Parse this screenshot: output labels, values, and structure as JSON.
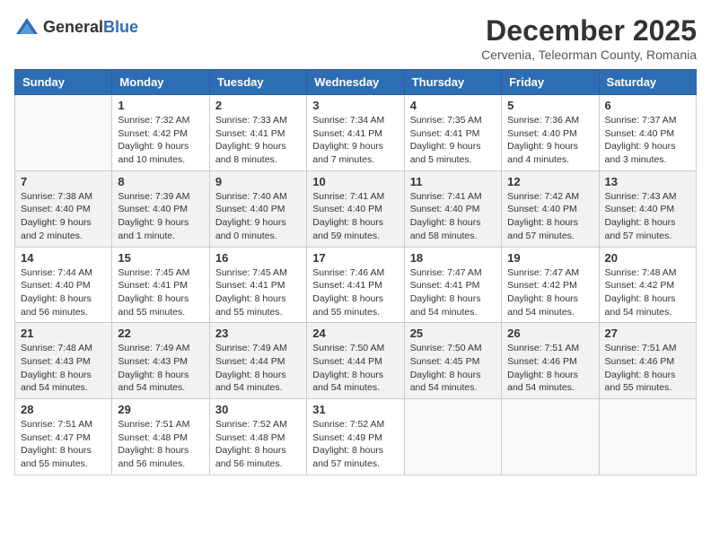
{
  "header": {
    "logo": {
      "general": "General",
      "blue": "Blue"
    },
    "month_title": "December 2025",
    "subtitle": "Cervenia, Teleorman County, Romania"
  },
  "weekdays": [
    "Sunday",
    "Monday",
    "Tuesday",
    "Wednesday",
    "Thursday",
    "Friday",
    "Saturday"
  ],
  "weeks": [
    [
      {
        "day": "",
        "sunrise": "",
        "sunset": "",
        "daylight": ""
      },
      {
        "day": "1",
        "sunrise": "Sunrise: 7:32 AM",
        "sunset": "Sunset: 4:42 PM",
        "daylight": "Daylight: 9 hours and 10 minutes."
      },
      {
        "day": "2",
        "sunrise": "Sunrise: 7:33 AM",
        "sunset": "Sunset: 4:41 PM",
        "daylight": "Daylight: 9 hours and 8 minutes."
      },
      {
        "day": "3",
        "sunrise": "Sunrise: 7:34 AM",
        "sunset": "Sunset: 4:41 PM",
        "daylight": "Daylight: 9 hours and 7 minutes."
      },
      {
        "day": "4",
        "sunrise": "Sunrise: 7:35 AM",
        "sunset": "Sunset: 4:41 PM",
        "daylight": "Daylight: 9 hours and 5 minutes."
      },
      {
        "day": "5",
        "sunrise": "Sunrise: 7:36 AM",
        "sunset": "Sunset: 4:40 PM",
        "daylight": "Daylight: 9 hours and 4 minutes."
      },
      {
        "day": "6",
        "sunrise": "Sunrise: 7:37 AM",
        "sunset": "Sunset: 4:40 PM",
        "daylight": "Daylight: 9 hours and 3 minutes."
      }
    ],
    [
      {
        "day": "7",
        "sunrise": "Sunrise: 7:38 AM",
        "sunset": "Sunset: 4:40 PM",
        "daylight": "Daylight: 9 hours and 2 minutes."
      },
      {
        "day": "8",
        "sunrise": "Sunrise: 7:39 AM",
        "sunset": "Sunset: 4:40 PM",
        "daylight": "Daylight: 9 hours and 1 minute."
      },
      {
        "day": "9",
        "sunrise": "Sunrise: 7:40 AM",
        "sunset": "Sunset: 4:40 PM",
        "daylight": "Daylight: 9 hours and 0 minutes."
      },
      {
        "day": "10",
        "sunrise": "Sunrise: 7:41 AM",
        "sunset": "Sunset: 4:40 PM",
        "daylight": "Daylight: 8 hours and 59 minutes."
      },
      {
        "day": "11",
        "sunrise": "Sunrise: 7:41 AM",
        "sunset": "Sunset: 4:40 PM",
        "daylight": "Daylight: 8 hours and 58 minutes."
      },
      {
        "day": "12",
        "sunrise": "Sunrise: 7:42 AM",
        "sunset": "Sunset: 4:40 PM",
        "daylight": "Daylight: 8 hours and 57 minutes."
      },
      {
        "day": "13",
        "sunrise": "Sunrise: 7:43 AM",
        "sunset": "Sunset: 4:40 PM",
        "daylight": "Daylight: 8 hours and 57 minutes."
      }
    ],
    [
      {
        "day": "14",
        "sunrise": "Sunrise: 7:44 AM",
        "sunset": "Sunset: 4:40 PM",
        "daylight": "Daylight: 8 hours and 56 minutes."
      },
      {
        "day": "15",
        "sunrise": "Sunrise: 7:45 AM",
        "sunset": "Sunset: 4:41 PM",
        "daylight": "Daylight: 8 hours and 55 minutes."
      },
      {
        "day": "16",
        "sunrise": "Sunrise: 7:45 AM",
        "sunset": "Sunset: 4:41 PM",
        "daylight": "Daylight: 8 hours and 55 minutes."
      },
      {
        "day": "17",
        "sunrise": "Sunrise: 7:46 AM",
        "sunset": "Sunset: 4:41 PM",
        "daylight": "Daylight: 8 hours and 55 minutes."
      },
      {
        "day": "18",
        "sunrise": "Sunrise: 7:47 AM",
        "sunset": "Sunset: 4:41 PM",
        "daylight": "Daylight: 8 hours and 54 minutes."
      },
      {
        "day": "19",
        "sunrise": "Sunrise: 7:47 AM",
        "sunset": "Sunset: 4:42 PM",
        "daylight": "Daylight: 8 hours and 54 minutes."
      },
      {
        "day": "20",
        "sunrise": "Sunrise: 7:48 AM",
        "sunset": "Sunset: 4:42 PM",
        "daylight": "Daylight: 8 hours and 54 minutes."
      }
    ],
    [
      {
        "day": "21",
        "sunrise": "Sunrise: 7:48 AM",
        "sunset": "Sunset: 4:43 PM",
        "daylight": "Daylight: 8 hours and 54 minutes."
      },
      {
        "day": "22",
        "sunrise": "Sunrise: 7:49 AM",
        "sunset": "Sunset: 4:43 PM",
        "daylight": "Daylight: 8 hours and 54 minutes."
      },
      {
        "day": "23",
        "sunrise": "Sunrise: 7:49 AM",
        "sunset": "Sunset: 4:44 PM",
        "daylight": "Daylight: 8 hours and 54 minutes."
      },
      {
        "day": "24",
        "sunrise": "Sunrise: 7:50 AM",
        "sunset": "Sunset: 4:44 PM",
        "daylight": "Daylight: 8 hours and 54 minutes."
      },
      {
        "day": "25",
        "sunrise": "Sunrise: 7:50 AM",
        "sunset": "Sunset: 4:45 PM",
        "daylight": "Daylight: 8 hours and 54 minutes."
      },
      {
        "day": "26",
        "sunrise": "Sunrise: 7:51 AM",
        "sunset": "Sunset: 4:46 PM",
        "daylight": "Daylight: 8 hours and 54 minutes."
      },
      {
        "day": "27",
        "sunrise": "Sunrise: 7:51 AM",
        "sunset": "Sunset: 4:46 PM",
        "daylight": "Daylight: 8 hours and 55 minutes."
      }
    ],
    [
      {
        "day": "28",
        "sunrise": "Sunrise: 7:51 AM",
        "sunset": "Sunset: 4:47 PM",
        "daylight": "Daylight: 8 hours and 55 minutes."
      },
      {
        "day": "29",
        "sunrise": "Sunrise: 7:51 AM",
        "sunset": "Sunset: 4:48 PM",
        "daylight": "Daylight: 8 hours and 56 minutes."
      },
      {
        "day": "30",
        "sunrise": "Sunrise: 7:52 AM",
        "sunset": "Sunset: 4:48 PM",
        "daylight": "Daylight: 8 hours and 56 minutes."
      },
      {
        "day": "31",
        "sunrise": "Sunrise: 7:52 AM",
        "sunset": "Sunset: 4:49 PM",
        "daylight": "Daylight: 8 hours and 57 minutes."
      },
      {
        "day": "",
        "sunrise": "",
        "sunset": "",
        "daylight": ""
      },
      {
        "day": "",
        "sunrise": "",
        "sunset": "",
        "daylight": ""
      },
      {
        "day": "",
        "sunrise": "",
        "sunset": "",
        "daylight": ""
      }
    ]
  ]
}
